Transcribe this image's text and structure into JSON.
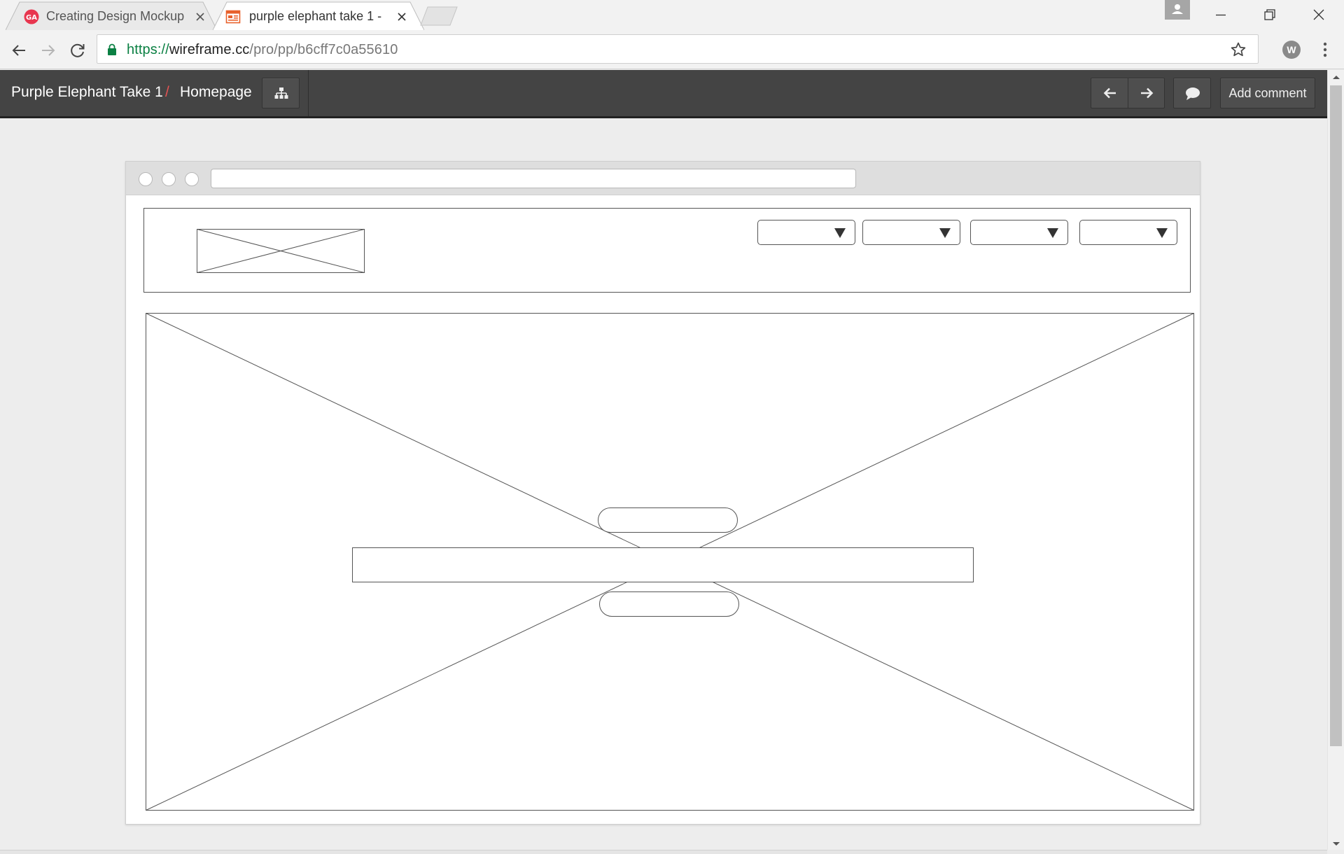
{
  "browser": {
    "tabs": [
      {
        "title": "Creating Design Mockup",
        "favicon": "general-assembly-logo-icon",
        "active": false
      },
      {
        "title": "purple elephant take 1 -",
        "favicon": "wireframe-page-icon",
        "active": true
      }
    ],
    "url": {
      "scheme": "https://",
      "host": "wireframe.cc",
      "path": "/pro/pp/b6cff7c0a55610"
    },
    "extension_label": "W"
  },
  "app": {
    "breadcrumb": {
      "project": "Purple Elephant Take 1",
      "separator": "/",
      "page": "Homepage"
    },
    "add_comment_label": "Add comment",
    "colors": {
      "header_bg": "#444444",
      "separator": "#e55353",
      "canvas_bg": "#ededed"
    }
  },
  "wireframe": {
    "header_selects": [
      "",
      "",
      "",
      ""
    ],
    "hero": {
      "top_pill": "",
      "text_bar": "",
      "bottom_pill": ""
    }
  }
}
